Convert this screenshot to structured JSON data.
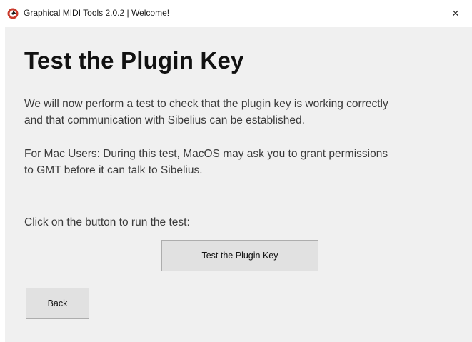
{
  "window": {
    "title": "Graphical MIDI Tools 2.0.2 | Welcome!",
    "close_glyph": "×",
    "app_icon": "gmt-logo-icon",
    "accent_color": "#c93a2c"
  },
  "main": {
    "heading": "Test the Plugin Key",
    "paragraph1_line1": "We will now perform a test to check that the plugin key is working correctly",
    "paragraph1_line2": "and that communication with Sibelius can be established.",
    "paragraph2_line1": "For Mac Users: During this test, MacOS may ask you to grant permissions",
    "paragraph2_line2": "to GMT before it can talk to Sibelius.",
    "instruction": "Click on the button to run the test:",
    "test_button_label": "Test the Plugin Key",
    "back_button_label": "Back"
  }
}
